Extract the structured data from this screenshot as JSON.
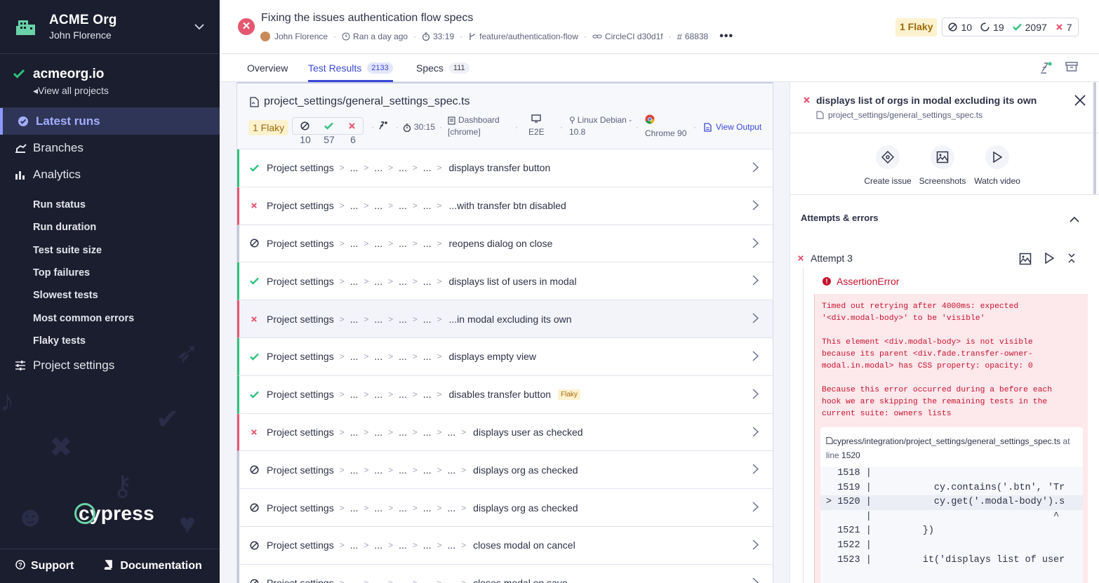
{
  "org": {
    "name": "ACME Org",
    "user": "John Florence"
  },
  "project": {
    "name": "acmeorg.io",
    "link": "View all projects"
  },
  "nav": {
    "latest_runs": "Latest runs",
    "branches": "Branches",
    "analytics": "Analytics",
    "analytics_items": [
      "Run status",
      "Run duration",
      "Test suite size",
      "Top failures",
      "Slowest tests",
      "Most common errors",
      "Flaky tests"
    ],
    "project_settings": "Project settings"
  },
  "footer": {
    "support": "Support",
    "documentation": "Documentation",
    "brand": "cypress"
  },
  "run": {
    "title": "Fixing the issues authentication flow specs",
    "author": "John Florence",
    "ran": "Ran a day ago",
    "duration": "33:19",
    "branch": "feature/authentication-flow",
    "ci": "CircleCI d30d1f",
    "number": "68838"
  },
  "header_stats": {
    "flaky": "1 Flaky",
    "skipped": "10",
    "pending": "19",
    "passed": "2097",
    "failed": "7"
  },
  "tabs": {
    "overview": "Overview",
    "test_results": "Test Results",
    "test_results_count": "2133",
    "specs": "Specs",
    "specs_count": "111"
  },
  "spec": {
    "path": "project_settings/general_settings_spec.ts",
    "flaky": "1 Flaky",
    "skipped": "10",
    "passed": "57",
    "failed": "6",
    "duration": "30:15",
    "group_line1": "Dashboard",
    "group_line2": "[chrome]",
    "type": "E2E",
    "os_line1": "Linux Debian -",
    "os_line2": "10.8",
    "browser": "Chrome 90",
    "view_output": "View Output"
  },
  "tests": [
    {
      "status": "pass",
      "group": "Project settings",
      "deep": false,
      "title": "displays transfer button",
      "flaky": ""
    },
    {
      "status": "fail",
      "group": "Project settings",
      "deep": false,
      "title": "...with transfer btn disabled",
      "flaky": ""
    },
    {
      "status": "skip",
      "group": "Project settings",
      "deep": false,
      "title": "reopens dialog on close",
      "flaky": ""
    },
    {
      "status": "pass",
      "group": "Project settings",
      "deep": false,
      "title": "displays list of users in modal",
      "flaky": ""
    },
    {
      "status": "fail",
      "group": "Project settings",
      "deep": false,
      "title": "...in modal excluding its own",
      "flaky": "",
      "selected": true
    },
    {
      "status": "pass",
      "group": "Project settings",
      "deep": false,
      "title": "displays empty view",
      "flaky": ""
    },
    {
      "status": "pass",
      "group": "Project settings",
      "deep": false,
      "title": "disables transfer button",
      "flaky": "Flaky"
    },
    {
      "status": "fail",
      "group": "Project settings",
      "deep": true,
      "title": "displays user as checked",
      "flaky": ""
    },
    {
      "status": "skip",
      "group": "Project settings",
      "deep": true,
      "title": "displays org as checked",
      "flaky": ""
    },
    {
      "status": "skip",
      "group": "Project settings",
      "deep": true,
      "title": "displays org as checked",
      "flaky": ""
    },
    {
      "status": "skip",
      "group": "Project settings",
      "deep": true,
      "title": "closes modal on cancel",
      "flaky": ""
    },
    {
      "status": "skip",
      "group": "Project settings",
      "deep": true,
      "title": "closes modal on save",
      "flaky": ""
    }
  ],
  "detail": {
    "title": "displays list of orgs in modal excluding its own",
    "path": "project_settings/general_settings_spec.ts",
    "actions": [
      "Create issue",
      "Screenshots",
      "Watch video"
    ],
    "attempts_heading": "Attempts & errors",
    "attempt": "Attempt 3",
    "error_name": "AssertionError",
    "error_message": "Timed out retrying after 4000ms: expected\n'<div.modal-body>' to be 'visible'\n\nThis element <div.modal-body> is not visible\nbecause its parent <div.fade.transfer-owner-\nmodal.in.modal> has CSS property: opacity: 0\n\nBecause this error occurred during a before each\nhook we are skipping the remaining tests in the\ncurrent suite: owners lists",
    "code_file": "cypress/integration/project_settings/general_settings_spec.ts",
    "code_at": "at",
    "code_line_label": "line",
    "code_line": "1520",
    "code": [
      {
        "t": "  1518 |"
      },
      {
        "t": "  1519 |           cy.contains('.btn', 'Tr"
      },
      {
        "t": "> 1520 |           cy.get('.modal-body').s",
        "hl": true
      },
      {
        "t": "       |                                ^"
      },
      {
        "t": "  1521 |         })"
      },
      {
        "t": "  1522 |"
      },
      {
        "t": "  1523 |         it('displays list of user"
      }
    ]
  }
}
